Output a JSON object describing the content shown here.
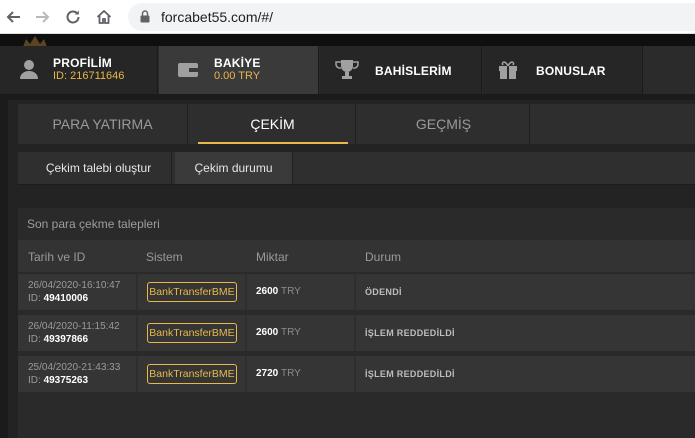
{
  "browser": {
    "url": "forcabet55.com/#/"
  },
  "topnav": {
    "profile": {
      "title": "PROFİLİM",
      "sub": "ID: 216711646"
    },
    "balance": {
      "title": "BAKİYE",
      "sub": "0.00 TRY"
    },
    "bets": {
      "title": "BAHİSLERİM"
    },
    "bonuses": {
      "title": "BONUSLAR"
    }
  },
  "tabs": [
    "PARA YATIRMA",
    "ÇEKİM",
    "GEÇMİŞ"
  ],
  "subtabs": [
    "Çekim talebi oluştur",
    "Çekim durumu"
  ],
  "section": {
    "title": "Son para çekme talepleri",
    "columns": [
      "Tarih ve ID",
      "Sistem",
      "Miktar",
      "Durum"
    ]
  },
  "rows": [
    {
      "date": "26/04/2020-16:10:47",
      "id_label": "ID:",
      "id": "49410006",
      "system": "BankTransferBME",
      "amount": "2600",
      "currency": "TRY",
      "status": "ÖDENDİ"
    },
    {
      "date": "26/04/2020-11:15:42",
      "id_label": "ID:",
      "id": "49397866",
      "system": "BankTransferBME",
      "amount": "2600",
      "currency": "TRY",
      "status": "İŞLEM REDDEDİLDİ"
    },
    {
      "date": "25/04/2020-21:43:33",
      "id_label": "ID:",
      "id": "49375263",
      "system": "BankTransferBME",
      "amount": "2720",
      "currency": "TRY",
      "status": "İŞLEM REDDEDİLDİ"
    }
  ],
  "colors": {
    "accent": "#e8b84a",
    "background": "#1b1b1b"
  }
}
